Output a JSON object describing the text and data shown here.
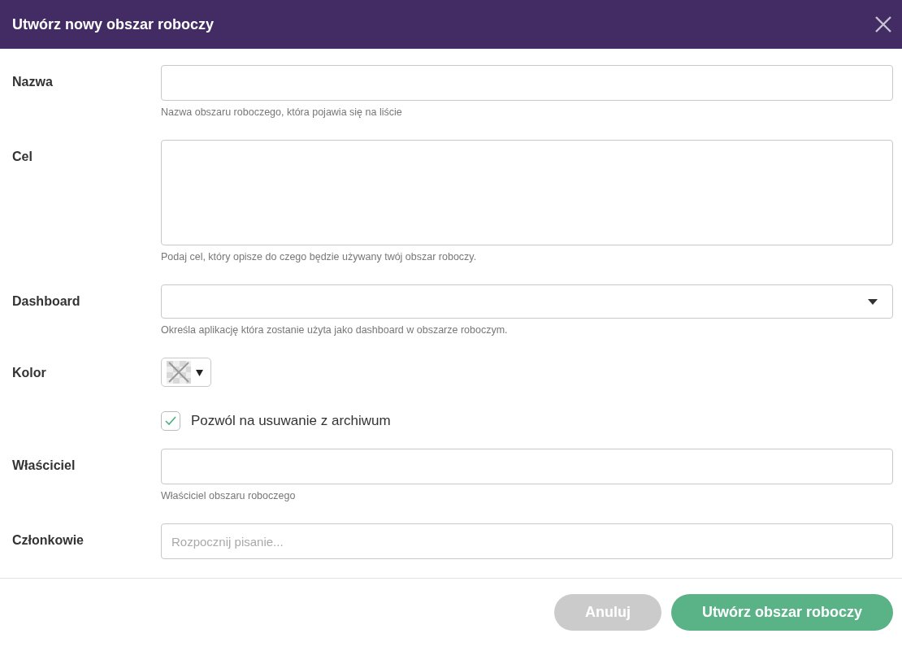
{
  "dialog": {
    "title": "Utwórz nowy obszar roboczy"
  },
  "fields": [
    {
      "kind": "text",
      "label": "Nazwa",
      "help": "Nazwa obszaru roboczego, która pojawia się na liście"
    },
    {
      "kind": "textarea",
      "label": "Cel",
      "help": "Podaj cel, który opisze do czego będzie używany twój obszar roboczy."
    },
    {
      "kind": "select",
      "label": "Dashboard",
      "help": "Określa aplikację która zostanie użyta jako dashboard w obszarze roboczym."
    },
    {
      "kind": "color",
      "label": "Kolor"
    },
    {
      "kind": "checkbox",
      "label": "Pozwól na usuwanie z archiwum",
      "checked": true
    },
    {
      "kind": "text",
      "label": "Właściciel",
      "help": "Właściciel obszaru roboczego"
    },
    {
      "kind": "text",
      "label": "Członkowie",
      "placeholder": "Rozpocznij pisanie..."
    }
  ],
  "buttons": [
    {
      "label": "Anuluj",
      "kind": "secondary",
      "disabled": true
    },
    {
      "label": "Utwórz obszar roboczy",
      "kind": "primary",
      "disabled": false
    }
  ]
}
